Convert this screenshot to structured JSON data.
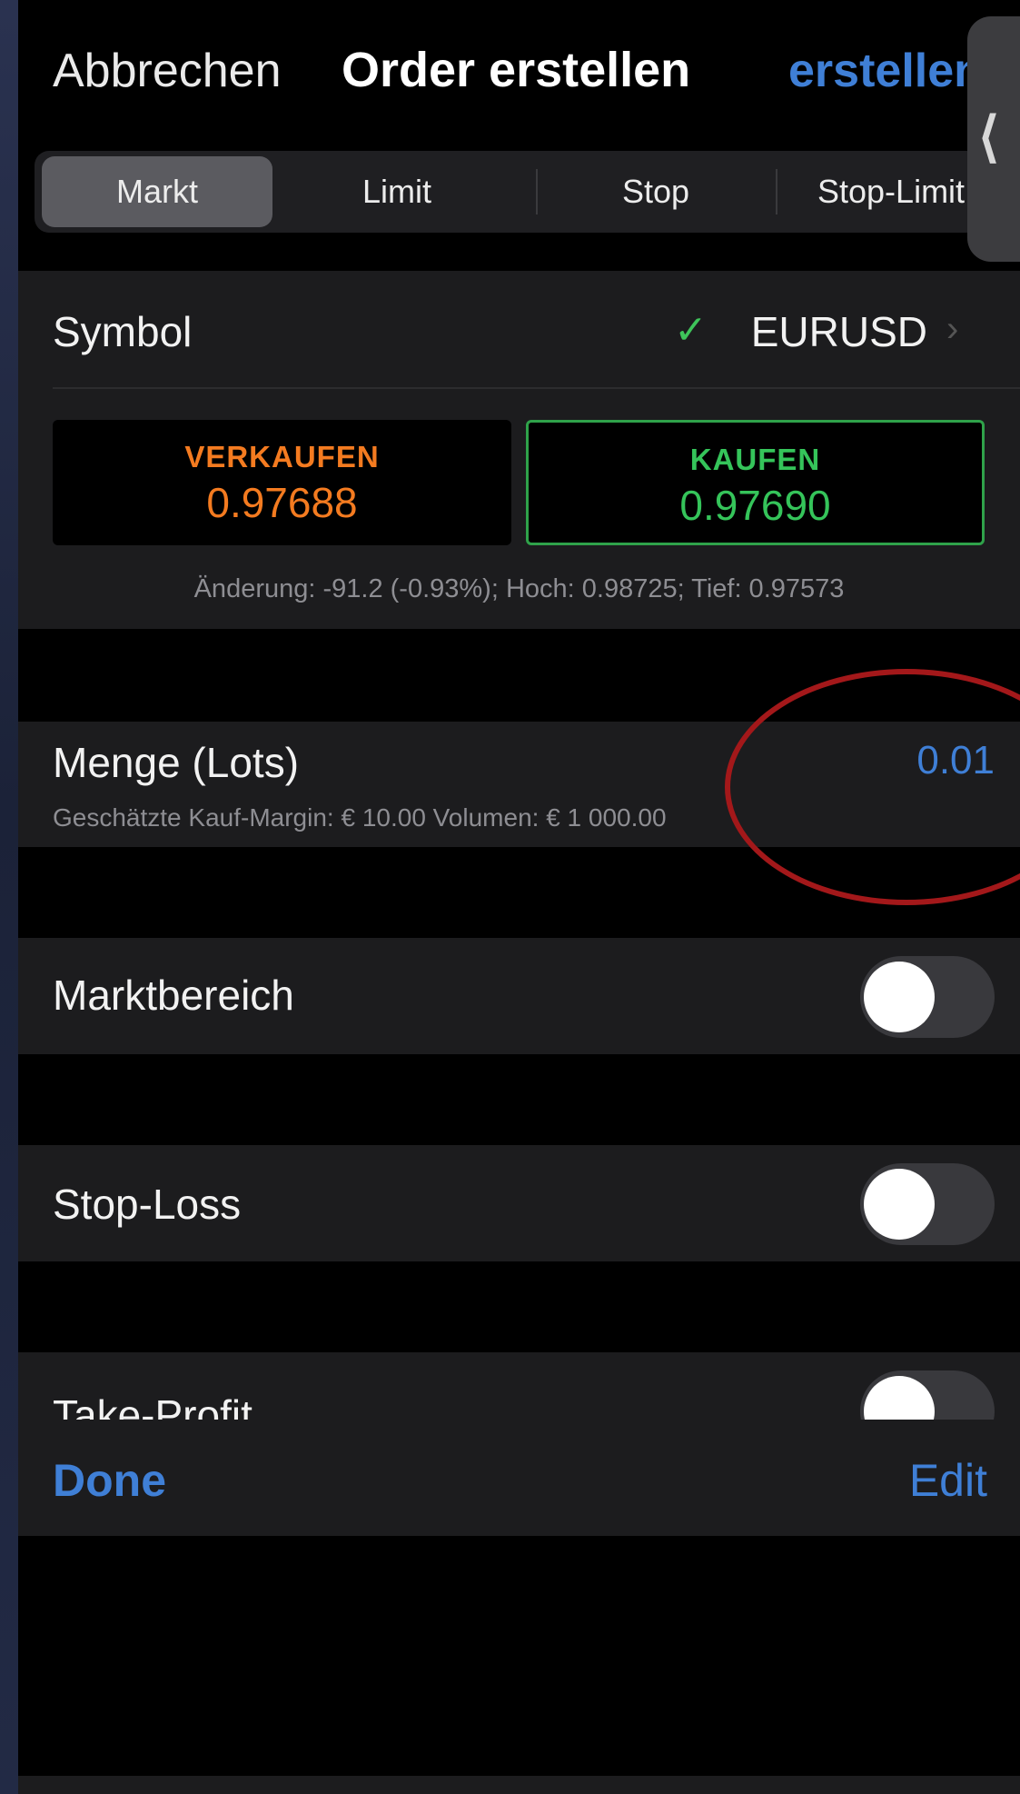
{
  "nav": {
    "cancel_label": "Abbrechen",
    "title": "Order erstellen",
    "create_label": "erstellen",
    "handle_glyph": "⟨"
  },
  "order_types": {
    "tabs": [
      "Markt",
      "Limit",
      "Stop",
      "Stop-Limit"
    ],
    "selected": "Markt"
  },
  "symbol": {
    "label": "Symbol",
    "value": "EURUSD",
    "check_icon": "✓",
    "chevron_icon": "›"
  },
  "prices": {
    "sell": {
      "label": "VERKAUFEN",
      "value": "0.97688",
      "color": "#f47b20"
    },
    "buy": {
      "label": "KAUFEN",
      "value": "0.97690",
      "color": "#35c45a"
    },
    "stats": "Änderung: -91.2 (-0.93%); Hoch: 0.98725; Tief: 0.97573"
  },
  "quantity": {
    "label": "Menge (Lots)",
    "value": "0.01",
    "margin_text": "Geschätzte Kauf-Margin: € 10.00   Volumen: € 1 000.00"
  },
  "toggles": {
    "market_range": {
      "label": "Marktbereich",
      "on": false
    },
    "stop_loss": {
      "label": "Stop-Loss",
      "on": false
    },
    "take_profit": {
      "label": "Take-Profit",
      "on": false
    }
  },
  "toolbar": {
    "done_label": "Done",
    "edit_label": "Edit"
  },
  "colors": {
    "accent": "#3f7fd6",
    "highlight_ellipse": "#a3181a"
  }
}
